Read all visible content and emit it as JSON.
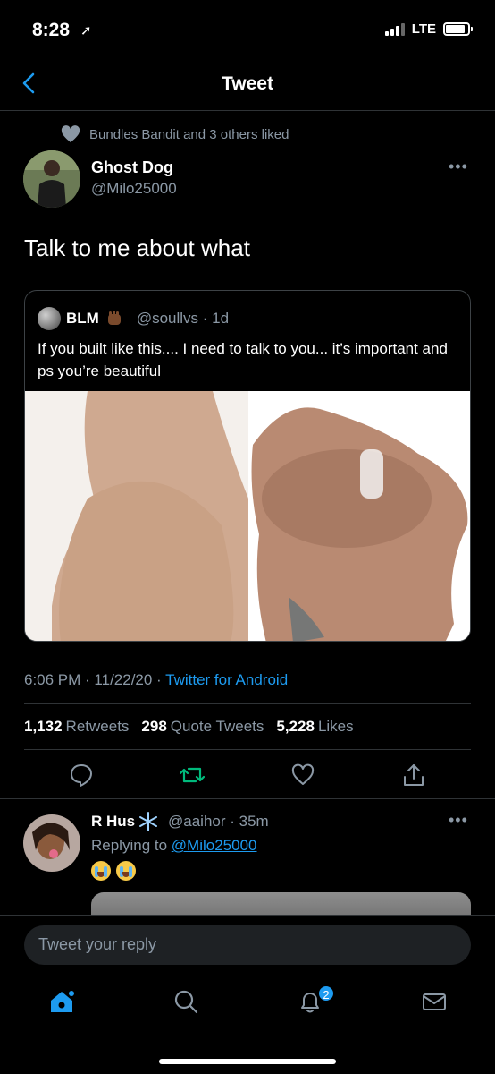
{
  "status": {
    "time": "8:28",
    "network": "LTE"
  },
  "nav": {
    "title": "Tweet"
  },
  "social_context": "Bundles Bandit and 3 others liked",
  "tweet": {
    "author_name": "Ghost Dog",
    "author_handle": "@Milo25000",
    "text": "Talk to me about what",
    "timestamp": "6:06 PM · 11/22/20 · ",
    "source": "Twitter for Android"
  },
  "quote": {
    "name": "BLM",
    "handle": "@soullvs · 1d",
    "text": "If you built like this.... I need to talk to you... it’s important and ps you’re beautiful"
  },
  "stats": {
    "retweets_count": "1,132",
    "retweets_label": "Retweets",
    "quotes_count": "298",
    "quotes_label": "Quote Tweets",
    "likes_count": "5,228",
    "likes_label": "Likes"
  },
  "reply": {
    "name": "R Hus",
    "handle": "@aaihor · 35m",
    "replying_prefix": "Replying to ",
    "replying_to": "@Milo25000"
  },
  "composer": {
    "placeholder": "Tweet your reply"
  },
  "tabbar": {
    "notifications_badge": "2"
  },
  "colors": {
    "accent": "#1d9bf0",
    "retweet": "#00ba7c",
    "muted": "#8b98a5",
    "background": "#000000"
  }
}
